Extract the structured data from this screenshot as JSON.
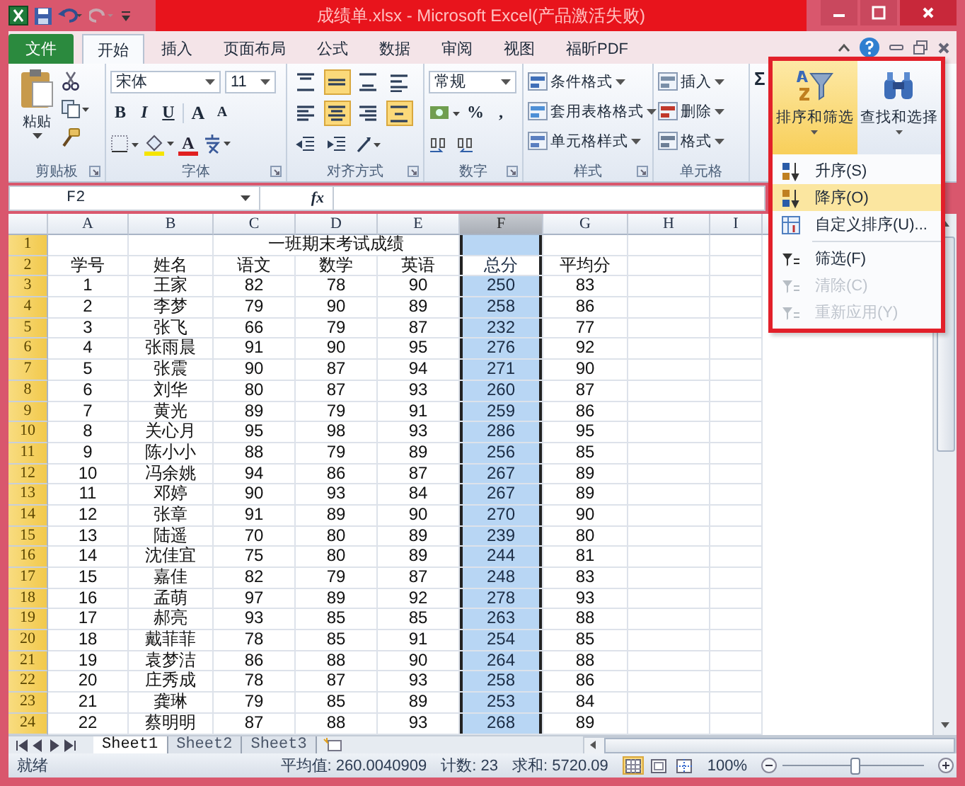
{
  "window": {
    "title": "成绩单.xlsx - Microsoft Excel(产品激活失败)"
  },
  "tabs": [
    {
      "label": "文件",
      "kind": "file",
      "selected": false
    },
    {
      "label": "开始",
      "kind": "tab",
      "selected": true
    },
    {
      "label": "插入",
      "kind": "tab",
      "selected": false
    },
    {
      "label": "页面布局",
      "kind": "tab",
      "selected": false
    },
    {
      "label": "公式",
      "kind": "tab",
      "selected": false
    },
    {
      "label": "数据",
      "kind": "tab",
      "selected": false
    },
    {
      "label": "审阅",
      "kind": "tab",
      "selected": false
    },
    {
      "label": "视图",
      "kind": "tab",
      "selected": false
    },
    {
      "label": "福昕PDF",
      "kind": "tab",
      "selected": false
    }
  ],
  "ribbon": {
    "groups": [
      {
        "kind": "clipboard",
        "label": "剪贴板",
        "launcher": true,
        "paste": "粘贴"
      },
      {
        "kind": "font",
        "label": "字体",
        "launcher": true,
        "font_name": "宋体",
        "font_size": "11",
        "styles": [
          "B",
          "I",
          "U"
        ],
        "size_buttons": [
          "A",
          "A"
        ],
        "color_button": "A"
      },
      {
        "kind": "alignment",
        "label": "对齐方式",
        "launcher": true,
        "buttons": [
          {
            "kind": "top",
            "selected": false
          },
          {
            "kind": "middle",
            "selected": true
          },
          {
            "kind": "bottom",
            "selected": false
          },
          {
            "kind": "wrap",
            "selected": false
          },
          {
            "kind": "left",
            "selected": false
          },
          {
            "kind": "center",
            "selected": true
          },
          {
            "kind": "right",
            "selected": false
          },
          {
            "kind": "merge",
            "selected": true
          }
        ]
      },
      {
        "kind": "number",
        "label": "数字",
        "launcher": true,
        "format": "常规",
        "symbols": [
          "%",
          ","
        ]
      },
      {
        "kind": "list",
        "label": "样式",
        "launcher": true,
        "items": [
          {
            "label": "条件格式",
            "kind": "conditional"
          },
          {
            "label": "套用表格格式",
            "kind": "table"
          },
          {
            "label": "单元格样式",
            "kind": "cellstyle"
          }
        ]
      },
      {
        "kind": "list",
        "label": "单元格",
        "items": [
          {
            "label": "插入",
            "kind": "insert"
          },
          {
            "label": "删除",
            "kind": "delete"
          },
          {
            "label": "格式",
            "kind": "format"
          }
        ]
      },
      {
        "kind": "editing",
        "symbol": "Σ"
      }
    ]
  },
  "sort_menu": {
    "buttons": [
      {
        "label": "排序和筛选",
        "kind": "sort",
        "selected": true
      },
      {
        "label": "查找和选择",
        "kind": "find",
        "selected": false
      }
    ],
    "items": [
      {
        "label": "升序(S)",
        "kind": "asc",
        "selected": false,
        "disabled": false
      },
      {
        "label": "降序(O)",
        "kind": "desc",
        "selected": true,
        "disabled": false
      },
      {
        "label": "自定义排序(U)...",
        "kind": "custom",
        "selected": false,
        "disabled": false
      },
      {
        "label": "筛选(F)",
        "kind": "filter",
        "selected": false,
        "disabled": false
      },
      {
        "label": "清除(C)",
        "kind": "clear",
        "selected": false,
        "disabled": true
      },
      {
        "label": "重新应用(Y)",
        "kind": "reapply",
        "selected": false,
        "disabled": true
      }
    ]
  },
  "formula_bar": {
    "name_box": "F2",
    "fx": "fx"
  },
  "sheet": {
    "columns": [
      {
        "label": "A",
        "selected": false
      },
      {
        "label": "B",
        "selected": false
      },
      {
        "label": "C",
        "selected": false
      },
      {
        "label": "D",
        "selected": false
      },
      {
        "label": "E",
        "selected": false
      },
      {
        "label": "F",
        "selected": true
      },
      {
        "label": "G",
        "selected": false
      },
      {
        "label": "H",
        "selected": false
      },
      {
        "label": "I",
        "selected": false
      }
    ],
    "rows": [
      {
        "number": "1",
        "kind": "title",
        "title": "一班期末考试成绩",
        "active": false
      },
      {
        "number": "2",
        "kind": "data",
        "active": true,
        "cells": [
          "学号",
          "姓名",
          "语文",
          "数学",
          "英语",
          "总分",
          "平均分"
        ]
      },
      {
        "number": "3",
        "kind": "data",
        "active": false,
        "cells": [
          "1",
          "王家",
          "82",
          "78",
          "90",
          "250",
          "83"
        ]
      },
      {
        "number": "4",
        "kind": "data",
        "active": false,
        "cells": [
          "2",
          "李梦",
          "79",
          "90",
          "89",
          "258",
          "86"
        ]
      },
      {
        "number": "5",
        "kind": "data",
        "active": false,
        "cells": [
          "3",
          "张飞",
          "66",
          "79",
          "87",
          "232",
          "77"
        ]
      },
      {
        "number": "6",
        "kind": "data",
        "active": false,
        "cells": [
          "4",
          "张雨晨",
          "91",
          "90",
          "95",
          "276",
          "92"
        ]
      },
      {
        "number": "7",
        "kind": "data",
        "active": false,
        "cells": [
          "5",
          "张震",
          "90",
          "87",
          "94",
          "271",
          "90"
        ]
      },
      {
        "number": "8",
        "kind": "data",
        "active": false,
        "cells": [
          "6",
          "刘华",
          "80",
          "87",
          "93",
          "260",
          "87"
        ]
      },
      {
        "number": "9",
        "kind": "data",
        "active": false,
        "cells": [
          "7",
          "黄光",
          "89",
          "79",
          "91",
          "259",
          "86"
        ]
      },
      {
        "number": "10",
        "kind": "data",
        "active": false,
        "cells": [
          "8",
          "关心月",
          "95",
          "98",
          "93",
          "286",
          "95"
        ]
      },
      {
        "number": "11",
        "kind": "data",
        "active": false,
        "cells": [
          "9",
          "陈小小",
          "88",
          "79",
          "89",
          "256",
          "85"
        ]
      },
      {
        "number": "12",
        "kind": "data",
        "active": false,
        "cells": [
          "10",
          "冯余姚",
          "94",
          "86",
          "87",
          "267",
          "89"
        ]
      },
      {
        "number": "13",
        "kind": "data",
        "active": false,
        "cells": [
          "11",
          "邓婷",
          "90",
          "93",
          "84",
          "267",
          "89"
        ]
      },
      {
        "number": "14",
        "kind": "data",
        "active": false,
        "cells": [
          "12",
          "张章",
          "91",
          "89",
          "90",
          "270",
          "90"
        ]
      },
      {
        "number": "15",
        "kind": "data",
        "active": false,
        "cells": [
          "13",
          "陆遥",
          "70",
          "80",
          "89",
          "239",
          "80"
        ]
      },
      {
        "number": "16",
        "kind": "data",
        "active": false,
        "cells": [
          "14",
          "沈佳宜",
          "75",
          "80",
          "89",
          "244",
          "81"
        ]
      },
      {
        "number": "17",
        "kind": "data",
        "active": false,
        "cells": [
          "15",
          "嘉佳",
          "82",
          "79",
          "87",
          "248",
          "83"
        ]
      },
      {
        "number": "18",
        "kind": "data",
        "active": false,
        "cells": [
          "16",
          "孟萌",
          "97",
          "89",
          "92",
          "278",
          "93"
        ]
      },
      {
        "number": "19",
        "kind": "data",
        "active": false,
        "cells": [
          "17",
          "郝亮",
          "93",
          "85",
          "85",
          "263",
          "88"
        ]
      },
      {
        "number": "20",
        "kind": "data",
        "active": false,
        "cells": [
          "18",
          "戴菲菲",
          "78",
          "85",
          "91",
          "254",
          "85"
        ]
      },
      {
        "number": "21",
        "kind": "data",
        "active": false,
        "cells": [
          "19",
          "袁梦洁",
          "86",
          "88",
          "90",
          "264",
          "88"
        ]
      },
      {
        "number": "22",
        "kind": "data",
        "active": false,
        "cells": [
          "20",
          "庄秀成",
          "78",
          "87",
          "93",
          "258",
          "86"
        ]
      },
      {
        "number": "23",
        "kind": "data",
        "active": false,
        "cells": [
          "21",
          "龚琳",
          "79",
          "85",
          "89",
          "253",
          "84"
        ]
      },
      {
        "number": "24",
        "kind": "data",
        "active": false,
        "cells": [
          "22",
          "蔡明明",
          "87",
          "88",
          "93",
          "268",
          "89"
        ]
      }
    ]
  },
  "sheet_tabs": [
    {
      "label": "Sheet1",
      "selected": true
    },
    {
      "label": "Sheet2",
      "selected": false
    },
    {
      "label": "Sheet3",
      "selected": false
    }
  ],
  "status_bar": {
    "state": "就绪",
    "average": "平均值: 260.0040909",
    "count": "计数: 23",
    "sum": "求和: 5720.09",
    "views": [
      {
        "kind": "normal",
        "selected": true
      },
      {
        "kind": "layout",
        "selected": false
      },
      {
        "kind": "pagebreak",
        "selected": false
      }
    ],
    "zoom": {
      "label": "100%",
      "level": 0.5
    }
  }
}
